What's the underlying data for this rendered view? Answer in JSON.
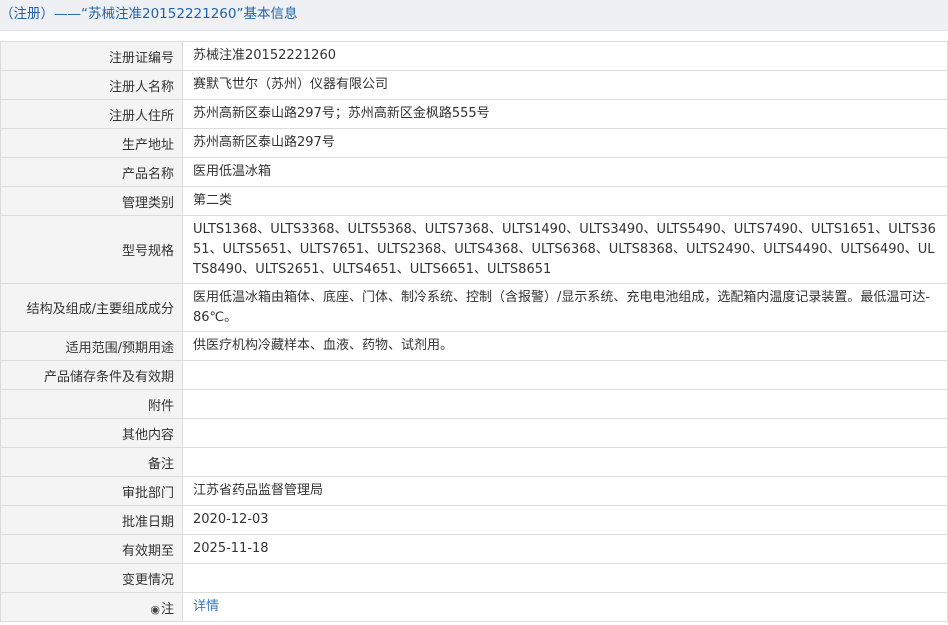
{
  "header": {
    "title": "（注册）——“苏械注准20152221260”基本信息"
  },
  "rows": [
    {
      "label": "注册证编号",
      "value": "苏械注准20152221260"
    },
    {
      "label": "注册人名称",
      "value": "赛默飞世尔（苏州）仪器有限公司"
    },
    {
      "label": "注册人住所",
      "value": "苏州高新区泰山路297号；苏州高新区金枫路555号"
    },
    {
      "label": "生产地址",
      "value": "苏州高新区泰山路297号"
    },
    {
      "label": "产品名称",
      "value": "医用低温冰箱"
    },
    {
      "label": "管理类别",
      "value": "第二类"
    },
    {
      "label": "型号规格",
      "value": "ULTS1368、ULTS3368、ULTS5368、ULTS7368、ULTS1490、ULTS3490、ULTS5490、ULTS7490、ULTS1651、ULTS3651、ULTS5651、ULTS7651、ULTS2368、ULTS4368、ULTS6368、ULTS8368、ULTS2490、ULTS4490、ULTS6490、ULTS8490、ULTS2651、ULTS4651、ULTS6651、ULTS8651"
    },
    {
      "label": "结构及组成/主要组成成分",
      "value": "医用低温冰箱由箱体、底座、门体、制冷系统、控制（含报警）/显示系统、充电电池组成，选配箱内温度记录装置。最低温可达-86℃。"
    },
    {
      "label": "适用范围/预期用途",
      "value": "供医疗机构冷藏样本、血液、药物、试剂用。"
    },
    {
      "label": "产品储存条件及有效期",
      "value": ""
    },
    {
      "label": "附件",
      "value": ""
    },
    {
      "label": "其他内容",
      "value": ""
    },
    {
      "label": "备注",
      "value": ""
    },
    {
      "label": "审批部门",
      "value": "江苏省药品监督管理局"
    },
    {
      "label": "批准日期",
      "value": "2020-12-03"
    },
    {
      "label": "有效期至",
      "value": "2025-11-18"
    },
    {
      "label": "变更情况",
      "value": ""
    }
  ],
  "note": {
    "icon": "note-icon",
    "label": "注",
    "link_text": "详情"
  }
}
